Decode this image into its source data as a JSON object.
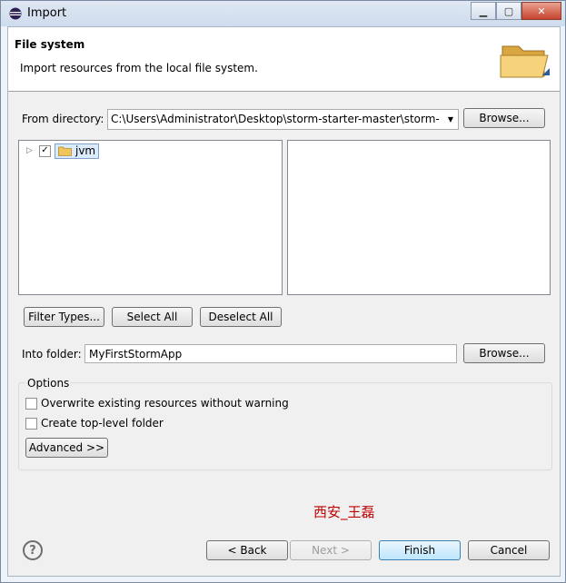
{
  "window": {
    "title": "Import"
  },
  "banner": {
    "title": "File system",
    "description": "Import resources from the local file system."
  },
  "from_directory": {
    "label": "From directory:",
    "value": "C:\\Users\\Administrator\\Desktop\\storm-starter-master\\storm-s",
    "browse_label": "Browse..."
  },
  "tree": {
    "items": [
      {
        "label": "jvm",
        "checked": true,
        "expanded": false
      }
    ]
  },
  "buttons": {
    "filter_types": "Filter Types...",
    "select_all": "Select All",
    "deselect_all": "Deselect All"
  },
  "into_folder": {
    "label": "Into folder:",
    "value": "MyFirstStormApp",
    "browse_label": "Browse..."
  },
  "options": {
    "group_label": "Options",
    "overwrite": "Overwrite existing resources without warning",
    "create_top_level": "Create top-level folder",
    "advanced": "Advanced >>"
  },
  "watermark": "西安_王磊",
  "footer": {
    "back": "< Back",
    "next": "Next >",
    "finish": "Finish",
    "cancel": "Cancel"
  },
  "colors": {
    "accent": "#3c7fb1",
    "watermark": "#c00000",
    "folder": "#f2c55c"
  }
}
